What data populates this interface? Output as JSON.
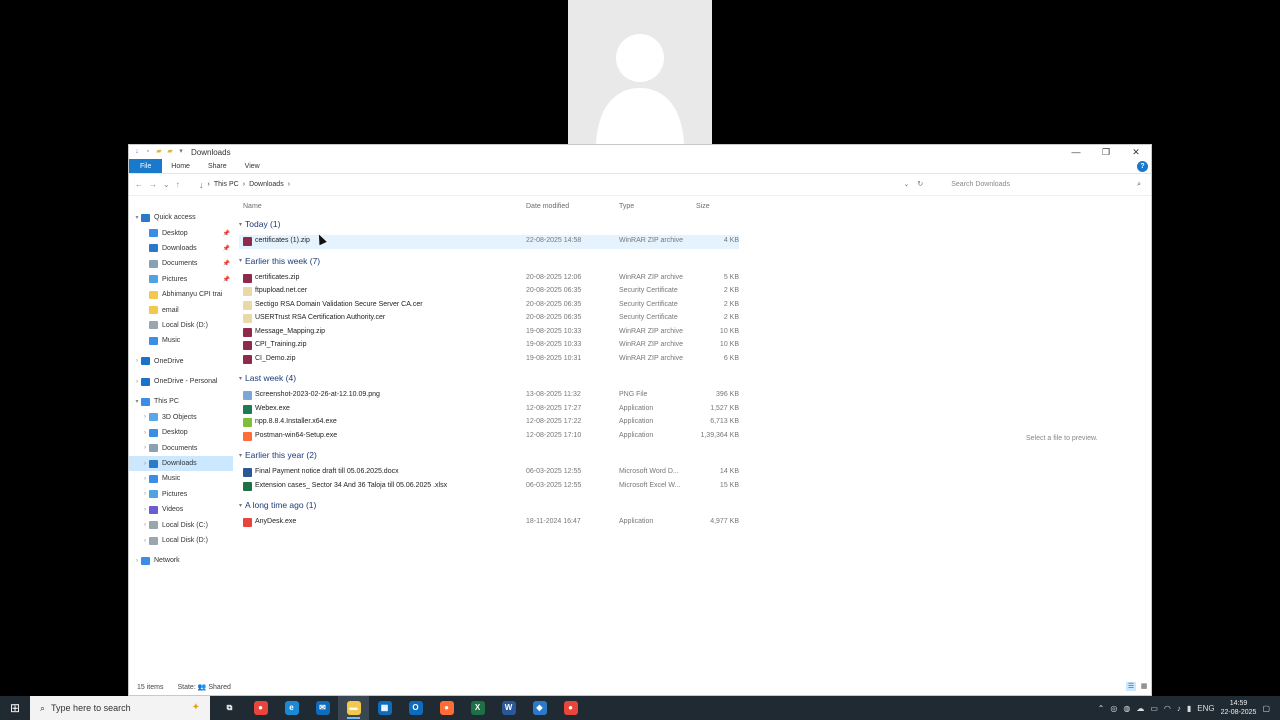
{
  "window": {
    "title": "Downloads",
    "ribbon_tabs": [
      "File",
      "Home",
      "Share",
      "View"
    ],
    "help": "?"
  },
  "address": {
    "path": [
      "This PC",
      "Downloads"
    ],
    "search_placeholder": "Search Downloads"
  },
  "nav": {
    "items": [
      {
        "label": "Quick access",
        "level": 0,
        "chev": "▾",
        "color": "#2b79c9"
      },
      {
        "label": "Desktop",
        "level": 1,
        "color": "#3a8ee6",
        "pinned": true
      },
      {
        "label": "Downloads",
        "level": 1,
        "color": "#2b79c9",
        "pinned": true
      },
      {
        "label": "Documents",
        "level": 1,
        "color": "#8aa1b4",
        "pinned": true
      },
      {
        "label": "Pictures",
        "level": 1,
        "color": "#4ea3e0",
        "pinned": true
      },
      {
        "label": "Abhimanyu CPI trai",
        "level": 1,
        "color": "#f2c94c"
      },
      {
        "label": "email",
        "level": 1,
        "color": "#f2c94c"
      },
      {
        "label": "Local Disk (D:)",
        "level": 1,
        "color": "#9aa6ad"
      },
      {
        "label": "Music",
        "level": 1,
        "color": "#3a8ee6"
      },
      {
        "label": "",
        "level": 0,
        "spacer": true
      },
      {
        "label": "OneDrive",
        "level": 0,
        "chev": "›",
        "color": "#1a73c8"
      },
      {
        "label": "",
        "level": 0,
        "spacer": true
      },
      {
        "label": "OneDrive - Personal",
        "level": 0,
        "chev": "›",
        "color": "#1a73c8"
      },
      {
        "label": "",
        "level": 0,
        "spacer": true
      },
      {
        "label": "This PC",
        "level": 0,
        "chev": "▾",
        "color": "#3a8ee6"
      },
      {
        "label": "3D Objects",
        "level": 1,
        "chev": "›",
        "color": "#5aa6e6"
      },
      {
        "label": "Desktop",
        "level": 1,
        "chev": "›",
        "color": "#3a8ee6"
      },
      {
        "label": "Documents",
        "level": 1,
        "chev": "›",
        "color": "#8aa1b4"
      },
      {
        "label": "Downloads",
        "level": 1,
        "chev": "›",
        "color": "#2b79c9",
        "selected": true
      },
      {
        "label": "Music",
        "level": 1,
        "chev": "›",
        "color": "#3a8ee6"
      },
      {
        "label": "Pictures",
        "level": 1,
        "chev": "›",
        "color": "#4ea3e0"
      },
      {
        "label": "Videos",
        "level": 1,
        "chev": "›",
        "color": "#6d5bd0"
      },
      {
        "label": "Local Disk (C:)",
        "level": 1,
        "chev": "›",
        "color": "#9aa6ad"
      },
      {
        "label": "Local Disk (D:)",
        "level": 1,
        "chev": "›",
        "color": "#9aa6ad"
      },
      {
        "label": "",
        "level": 0,
        "spacer": true
      },
      {
        "label": "Network",
        "level": 0,
        "chev": "›",
        "color": "#3a8ee6"
      }
    ]
  },
  "columns": {
    "name": "Name",
    "date": "Date modified",
    "type": "Type",
    "size": "Size"
  },
  "groups": [
    {
      "label": "Today (1)",
      "files": [
        {
          "name": "certificates (1).zip",
          "date": "22-08-2025 14:58",
          "type": "WinRAR ZIP archive",
          "size": "4 KB",
          "icon": "zip",
          "hover": true
        }
      ]
    },
    {
      "label": "Earlier this week (7)",
      "files": [
        {
          "name": "certificates.zip",
          "date": "20-08-2025 12:06",
          "type": "WinRAR ZIP archive",
          "size": "5 KB",
          "icon": "zip"
        },
        {
          "name": "ftpupload.net.cer",
          "date": "20-08-2025 06:35",
          "type": "Security Certificate",
          "size": "2 KB",
          "icon": "cert"
        },
        {
          "name": "Sectigo RSA Domain Validation Secure Server CA.cer",
          "date": "20-08-2025 06:35",
          "type": "Security Certificate",
          "size": "2 KB",
          "icon": "cert"
        },
        {
          "name": "USERTrust RSA Certification Authority.cer",
          "date": "20-08-2025 06:35",
          "type": "Security Certificate",
          "size": "2 KB",
          "icon": "cert"
        },
        {
          "name": "Message_Mapping.zip",
          "date": "19-08-2025 10:33",
          "type": "WinRAR ZIP archive",
          "size": "10 KB",
          "icon": "zip"
        },
        {
          "name": "CPI_Training.zip",
          "date": "19-08-2025 10:33",
          "type": "WinRAR ZIP archive",
          "size": "10 KB",
          "icon": "zip"
        },
        {
          "name": "CI_Demo.zip",
          "date": "19-08-2025 10:31",
          "type": "WinRAR ZIP archive",
          "size": "6 KB",
          "icon": "zip"
        }
      ]
    },
    {
      "label": "Last week (4)",
      "files": [
        {
          "name": "Screenshot-2023-02-26-at-12.10.09.png",
          "date": "13-08-2025 11:32",
          "type": "PNG File",
          "size": "396 KB",
          "icon": "png"
        },
        {
          "name": "Webex.exe",
          "date": "12-08-2025 17:27",
          "type": "Application",
          "size": "1,527 KB",
          "icon": "webex"
        },
        {
          "name": "npp.8.8.4.Installer.x64.exe",
          "date": "12-08-2025 17:22",
          "type": "Application",
          "size": "6,713 KB",
          "icon": "npp"
        },
        {
          "name": "Postman-win64-Setup.exe",
          "date": "12-08-2025 17:10",
          "type": "Application",
          "size": "1,39,364 KB",
          "icon": "postman"
        }
      ]
    },
    {
      "label": "Earlier this year (2)",
      "files": [
        {
          "name": "Final Payment notice draft till 05.06.2025.docx",
          "date": "06-03-2025 12:55",
          "type": "Microsoft Word D...",
          "size": "14 KB",
          "icon": "word"
        },
        {
          "name": "Extension cases_ Sector 34 And 36 Taloja till 05.06.2025 .xlsx",
          "date": "06-03-2025 12:55",
          "type": "Microsoft Excel W...",
          "size": "15 KB",
          "icon": "excel"
        }
      ]
    },
    {
      "label": "A long time ago (1)",
      "files": [
        {
          "name": "AnyDesk.exe",
          "date": "18-11-2024 16:47",
          "type": "Application",
          "size": "4,977 KB",
          "icon": "anydesk"
        }
      ]
    }
  ],
  "icon_colors": {
    "zip": "#8e2a4a",
    "cert": "#e8d9a8",
    "png": "#7aa7d8",
    "webex": "#1f7b55",
    "npp": "#7dbf3a",
    "postman": "#ff6c37",
    "word": "#2b5797",
    "excel": "#1e7145",
    "anydesk": "#e8453c"
  },
  "preview": "Select a file to preview.",
  "status": {
    "items": "15 items",
    "state": "State: 👥 Shared"
  },
  "taskbar": {
    "search_placeholder": "Type here to search",
    "apps": [
      {
        "name": "task-view",
        "glyph": "⧉",
        "color": "transparent"
      },
      {
        "name": "chrome",
        "glyph": "●",
        "color": "#e8453c"
      },
      {
        "name": "edge",
        "glyph": "e",
        "color": "#1a8ad4"
      },
      {
        "name": "mail",
        "glyph": "✉",
        "color": "#0f6cbd"
      },
      {
        "name": "file-explorer",
        "glyph": "▬",
        "color": "#f2c94c",
        "active": true
      },
      {
        "name": "calculator",
        "glyph": "▦",
        "color": "#0f6cbd"
      },
      {
        "name": "outlook",
        "glyph": "O",
        "color": "#0f6cbd"
      },
      {
        "name": "postman",
        "glyph": "●",
        "color": "#ff6c37"
      },
      {
        "name": "excel",
        "glyph": "X",
        "color": "#1e7145"
      },
      {
        "name": "webex",
        "glyph": "W",
        "color": "#2b5797"
      },
      {
        "name": "vs-app",
        "glyph": "◆",
        "color": "#2b79c9"
      },
      {
        "name": "chrome-2",
        "glyph": "●",
        "color": "#e8453c"
      }
    ],
    "lang": "ENG",
    "time": "14:59",
    "date": "22-08-2025"
  }
}
